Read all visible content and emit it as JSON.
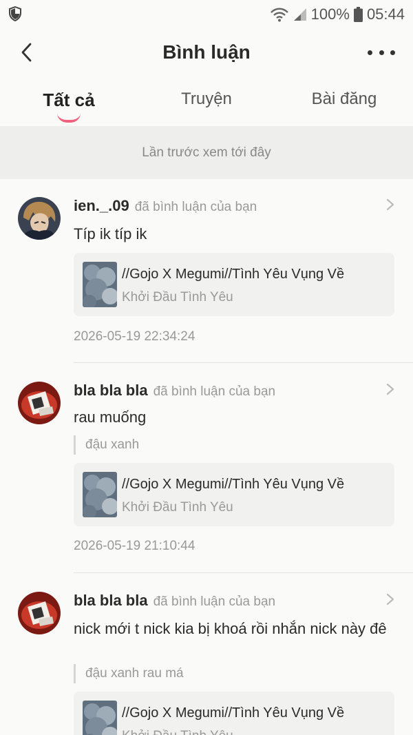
{
  "status_bar": {
    "battery": "100%",
    "time": "05:44",
    "icons": [
      "shield-icon",
      "wifi-icon",
      "signal-icon",
      "battery-icon"
    ]
  },
  "header": {
    "title": "Bình luận",
    "back_icon": "chevron-left-icon",
    "more_icon": "more-dots-icon"
  },
  "tabs": [
    {
      "label": "Tất cả",
      "active": true
    },
    {
      "label": "Truyện",
      "active": false
    },
    {
      "label": "Bài đăng",
      "active": false
    }
  ],
  "accent_color": "#f0607f",
  "last_viewed_label": "Lần trước xem tới đây",
  "comments": [
    {
      "username": "ien._.09",
      "action": "đã bình luận của bạn",
      "text": "Típ ik típ ik",
      "quote": "",
      "story_title": "//Gojo X Megumi//Tình Yêu Vụng Về",
      "story_chapter": "Khởi Đầu Tình Yêu",
      "timestamp": "2026-05-19 22:34:24"
    },
    {
      "username": "bla bla bla",
      "action": "đã bình luận của bạn",
      "text": "rau muống",
      "quote": "đậu xanh",
      "story_title": "//Gojo X Megumi//Tình Yêu Vụng Về",
      "story_chapter": "Khởi Đầu Tình Yêu",
      "timestamp": "2026-05-19 21:10:44"
    },
    {
      "username": "bla bla bla",
      "action": "đã bình luận của bạn",
      "text": "nick mới t nick kia bị khoá rồi nhắn nick này đê",
      "quote": "đậu xanh rau má",
      "story_title": "//Gojo X Megumi//Tình Yêu Vụng Về",
      "story_chapter": "Khởi Đầu Tình Yêu",
      "timestamp": ""
    }
  ]
}
